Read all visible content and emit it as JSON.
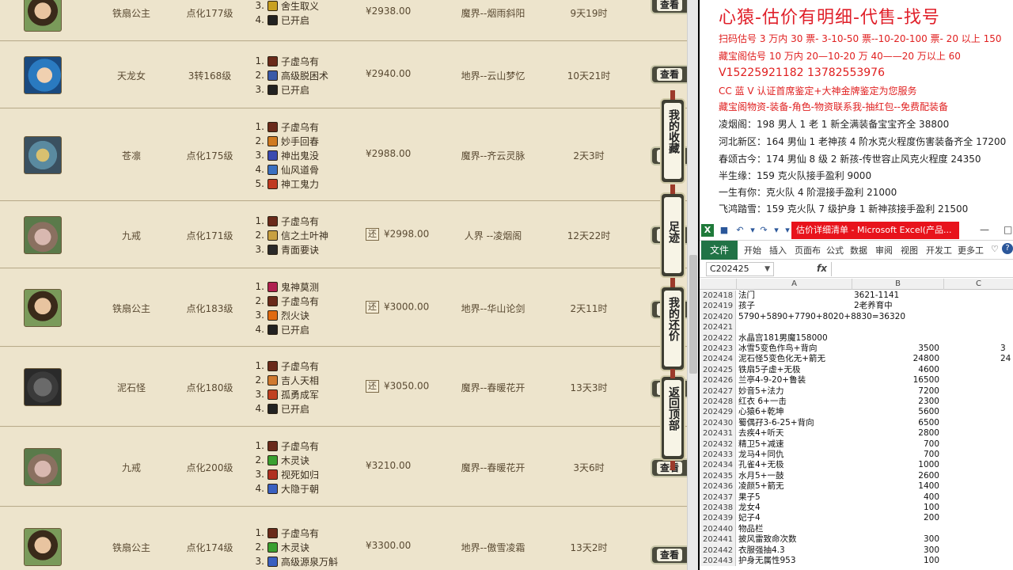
{
  "listing": {
    "view_label": "查看",
    "rows": [
      {
        "name": "铁扇公主",
        "level": "点化177级",
        "price": "¥2938.00",
        "server": "魔界--烟雨斜阳",
        "time": "9天19时",
        "haggle": "",
        "avatar": "avatar-princess-icon",
        "skills": [
          {
            "n": "3.",
            "name": "舍生取义",
            "color": "#c8a020"
          },
          {
            "n": "4.",
            "name": "已开启",
            "color": "#222222"
          }
        ]
      },
      {
        "name": "天龙女",
        "level": "3转168级",
        "price": "¥2940.00",
        "server": "地界--云山梦忆",
        "time": "10天21时",
        "haggle": "",
        "avatar": "avatar-dragon-girl-icon",
        "skills": [
          {
            "n": "1.",
            "name": "子虚乌有",
            "color": "#6a2a1a"
          },
          {
            "n": "2.",
            "name": "高级脱困术",
            "color": "#3a5aa8"
          },
          {
            "n": "3.",
            "name": "已开启",
            "color": "#222222"
          }
        ]
      },
      {
        "name": "苍凛",
        "level": "点化175级",
        "price": "¥2988.00",
        "server": "魔界--齐云灵脉",
        "time": "2天3时",
        "haggle": "",
        "avatar": "avatar-ice-warrior-icon",
        "skills": [
          {
            "n": "1.",
            "name": "子虚乌有",
            "color": "#6a2a1a"
          },
          {
            "n": "2.",
            "name": "妙手回春",
            "color": "#d07a20"
          },
          {
            "n": "3.",
            "name": "神出鬼没",
            "color": "#3a4ab0"
          },
          {
            "n": "4.",
            "name": "仙风道骨",
            "color": "#3a70c0"
          },
          {
            "n": "5.",
            "name": "神工鬼力",
            "color": "#c03a20"
          }
        ]
      },
      {
        "name": "九戒",
        "level": "点化171级",
        "price": "¥2998.00",
        "server": "人界 --凌烟阁",
        "time": "12天22时",
        "haggle": "还",
        "avatar": "avatar-pig-icon",
        "skills": [
          {
            "n": "1.",
            "name": "子虚乌有",
            "color": "#6a2a1a"
          },
          {
            "n": "2.",
            "name": "信之土叶神",
            "color": "#c8a040"
          },
          {
            "n": "3.",
            "name": "青面要诀",
            "color": "#2a2a2a"
          }
        ]
      },
      {
        "name": "铁扇公主",
        "level": "点化183级",
        "price": "¥3000.00",
        "server": "地界--华山论剑",
        "time": "2天11时",
        "haggle": "还",
        "avatar": "avatar-princess-icon",
        "skills": [
          {
            "n": "1.",
            "name": "鬼神莫测",
            "color": "#b02050"
          },
          {
            "n": "2.",
            "name": "子虚乌有",
            "color": "#6a2a1a"
          },
          {
            "n": "3.",
            "name": "烈火诀",
            "color": "#e06a10"
          },
          {
            "n": "4.",
            "name": "已开启",
            "color": "#222222"
          }
        ]
      },
      {
        "name": "泥石怪",
        "level": "点化180级",
        "price": "¥3050.00",
        "server": "魔界--春暖花开",
        "time": "13天3时",
        "haggle": "还",
        "avatar": "avatar-rock-monster-icon",
        "skills": [
          {
            "n": "1.",
            "name": "子虚乌有",
            "color": "#6a2a1a"
          },
          {
            "n": "2.",
            "name": "吉人天相",
            "color": "#d07a30"
          },
          {
            "n": "3.",
            "name": "孤勇成军",
            "color": "#c04020"
          },
          {
            "n": "4.",
            "name": "已开启",
            "color": "#222222"
          }
        ]
      },
      {
        "name": "九戒",
        "level": "点化200级",
        "price": "¥3210.00",
        "server": "魔界--春暖花开",
        "time": "3天6时",
        "haggle": "",
        "avatar": "avatar-pig-icon",
        "skills": [
          {
            "n": "1.",
            "name": "子虚乌有",
            "color": "#6a2a1a"
          },
          {
            "n": "2.",
            "name": "木灵诀",
            "color": "#3aa030"
          },
          {
            "n": "3.",
            "name": "视死如归",
            "color": "#b03020"
          },
          {
            "n": "4.",
            "name": "大隐于朝",
            "color": "#3a60c0"
          }
        ]
      },
      {
        "name": "铁扇公主",
        "level": "点化174级",
        "price": "¥3300.00",
        "server": "地界--傲雪凌霜",
        "time": "13天2时",
        "haggle": "",
        "avatar": "avatar-princess-icon",
        "skills": [
          {
            "n": "1.",
            "name": "子虚乌有",
            "color": "#6a2a1a"
          },
          {
            "n": "2.",
            "name": "木灵诀",
            "color": "#3aa030"
          },
          {
            "n": "3.",
            "name": "高级源泉万斛",
            "color": "#3a60c0"
          }
        ]
      }
    ]
  },
  "side_nav": [
    {
      "label": "我的收藏"
    },
    {
      "label": "足迹"
    },
    {
      "label": "我的还价"
    },
    {
      "label": "返回顶部"
    }
  ],
  "notes": {
    "title": "心猿-估价有明细-代售-找号",
    "lines": [
      {
        "text": "扫码估号 3 万内 30 票- 3-10-50 票--10-20-100 票- 20 以上 150",
        "style": "red"
      },
      {
        "text": "藏宝阁估号 10 万内 20—10-20 万 40——20 万以上 60",
        "style": "red"
      },
      {
        "text": "V15225921182   13782553976",
        "style": "red-big"
      },
      {
        "text": "CC 蓝 V 认证首席鉴定+大神金牌鉴定为您服务",
        "style": "red"
      },
      {
        "text": "藏宝阁物资-装备-角色-物资联系我-抽红包--免费配装备",
        "style": "red"
      },
      {
        "text": "凌烟阁：198 男人 1 老 1 新全满装备宝宝齐全 38800",
        "style": "black"
      },
      {
        "text": "河北新区：164 男仙 1 老神孩 4 阶水克火程度伤害装备齐全 17200",
        "style": "black"
      },
      {
        "text": "春颂古今：174 男仙 8 级 2 新孩-传世容止风克火程度 24350",
        "style": "black"
      },
      {
        "text": "半生缘：159 克火队接手盈利 9000",
        "style": "black"
      },
      {
        "text": "一生有你：克火队 4 阶混接手盈利 21000",
        "style": "black"
      },
      {
        "text": "飞鸿踏雪：159 克火队 7 级护身 1 新神孩接手盈利 21500",
        "style": "black"
      }
    ]
  },
  "excel": {
    "title": "估价详细清单 - Microsoft Excel(产品...",
    "tabs": [
      "开始",
      "插入",
      "页面布",
      "公式",
      "数据",
      "审阅",
      "视图",
      "开发工",
      "更多工"
    ],
    "file_tab": "文件",
    "name_box": "C202425",
    "fx": "fx",
    "columns": [
      "A",
      "B",
      "C"
    ],
    "rows": [
      {
        "r": "202418",
        "a": "法门",
        "b": "3621-1141",
        "bt": true,
        "c": ""
      },
      {
        "r": "202419",
        "a": "孩子",
        "b": "2老养育中",
        "bt": true,
        "c": ""
      },
      {
        "r": "202420",
        "a": "5790+5890+7790+8020+8830=36320",
        "b": "",
        "bt": false,
        "c": ""
      },
      {
        "r": "202421",
        "a": "",
        "b": "",
        "bt": false,
        "c": ""
      },
      {
        "r": "202422",
        "a": "水晶宫181男魔158000",
        "b": "",
        "bt": false,
        "c": ""
      },
      {
        "r": "202423",
        "a": "冰雪5变色作鸟+背向",
        "b": "3500",
        "bt": false,
        "c": "3"
      },
      {
        "r": "202424",
        "a": "泥石怪5变色化无+箭无",
        "b": "24800",
        "bt": false,
        "c": "24"
      },
      {
        "r": "202425",
        "a": "铁扇5子虚+无极",
        "b": "4600",
        "bt": false,
        "c": ""
      },
      {
        "r": "202426",
        "a": "兰亭4-9-20+鲁装",
        "b": "16500",
        "bt": false,
        "c": ""
      },
      {
        "r": "202427",
        "a": "妙音5+法力",
        "b": "7200",
        "bt": false,
        "c": ""
      },
      {
        "r": "202428",
        "a": "红衣 6+一击",
        "b": "2300",
        "bt": false,
        "c": ""
      },
      {
        "r": "202429",
        "a": "心猿6+乾坤",
        "b": "5600",
        "bt": false,
        "c": ""
      },
      {
        "r": "202430",
        "a": "蜀偶孖3-6-25+背向",
        "b": "6500",
        "bt": false,
        "c": ""
      },
      {
        "r": "202431",
        "a": "去疾4+听天",
        "b": "2800",
        "bt": false,
        "c": ""
      },
      {
        "r": "202432",
        "a": "精卫5+减速",
        "b": "700",
        "bt": false,
        "c": ""
      },
      {
        "r": "202433",
        "a": "龙马4+同仇",
        "b": "700",
        "bt": false,
        "c": ""
      },
      {
        "r": "202434",
        "a": "孔雀4+无极",
        "b": "1000",
        "bt": false,
        "c": ""
      },
      {
        "r": "202435",
        "a": "水月5+一鼓",
        "b": "2600",
        "bt": false,
        "c": ""
      },
      {
        "r": "202436",
        "a": "凌颜5+箭无",
        "b": "1400",
        "bt": false,
        "c": ""
      },
      {
        "r": "202437",
        "a": "果子5",
        "b": "400",
        "bt": false,
        "c": ""
      },
      {
        "r": "202438",
        "a": "龙女4",
        "b": "100",
        "bt": false,
        "c": ""
      },
      {
        "r": "202439",
        "a": "妃子4",
        "b": "200",
        "bt": false,
        "c": ""
      },
      {
        "r": "202440",
        "a": "物品栏",
        "b": "",
        "bt": false,
        "c": ""
      },
      {
        "r": "202441",
        "a": "披风雷致命次数",
        "b": "300",
        "bt": false,
        "c": ""
      },
      {
        "r": "202442",
        "a": "衣服强抽4.3",
        "b": "300",
        "bt": false,
        "c": ""
      },
      {
        "r": "202443",
        "a": "护身无属性953",
        "b": "100",
        "bt": false,
        "c": ""
      }
    ]
  }
}
